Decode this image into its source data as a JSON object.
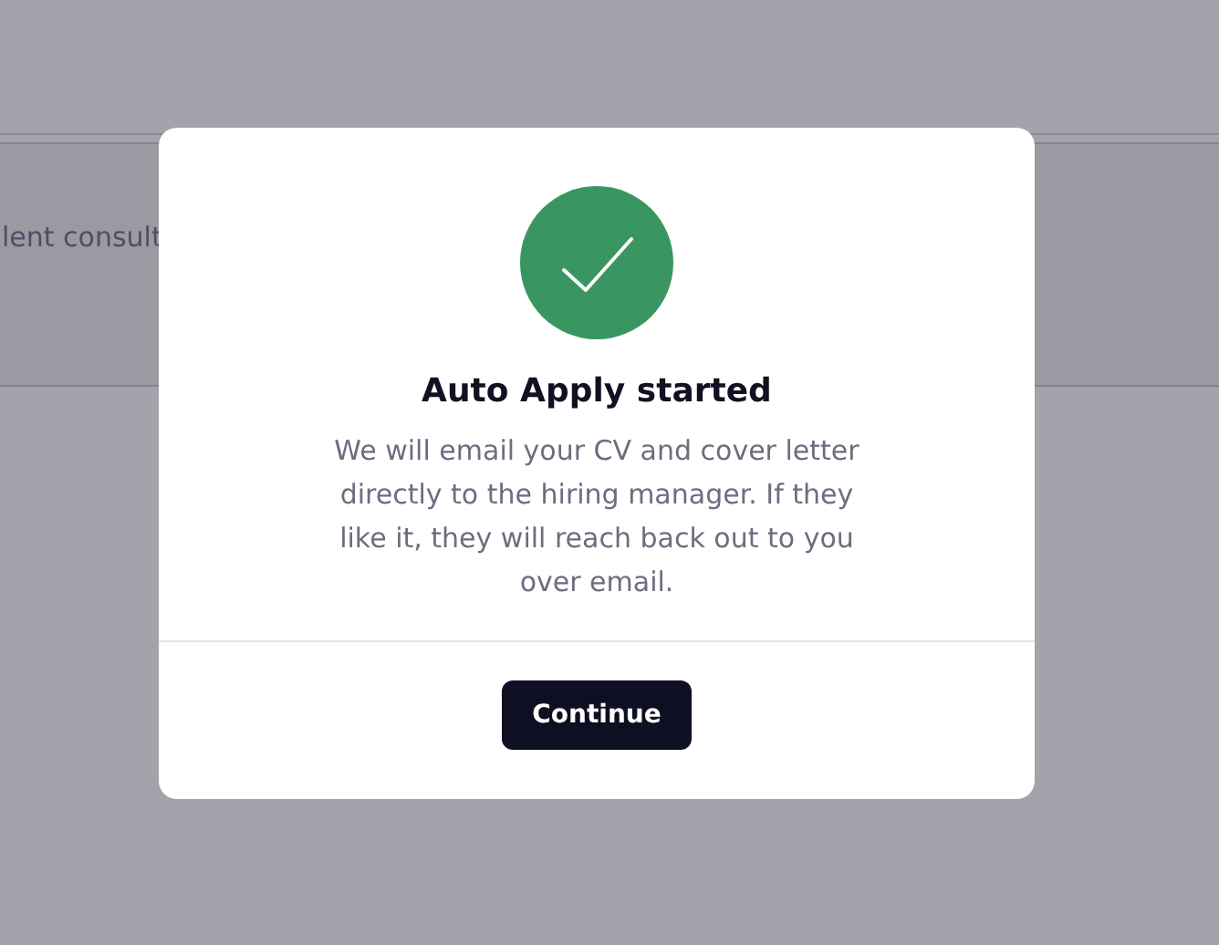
{
  "background": {
    "row_text": "lent consult"
  },
  "modal": {
    "title": "Auto Apply started",
    "message": "We will email your CV and cover letter directly to the hiring manager. If they like it, they will reach back out to you over email.",
    "button": "Continue"
  }
}
